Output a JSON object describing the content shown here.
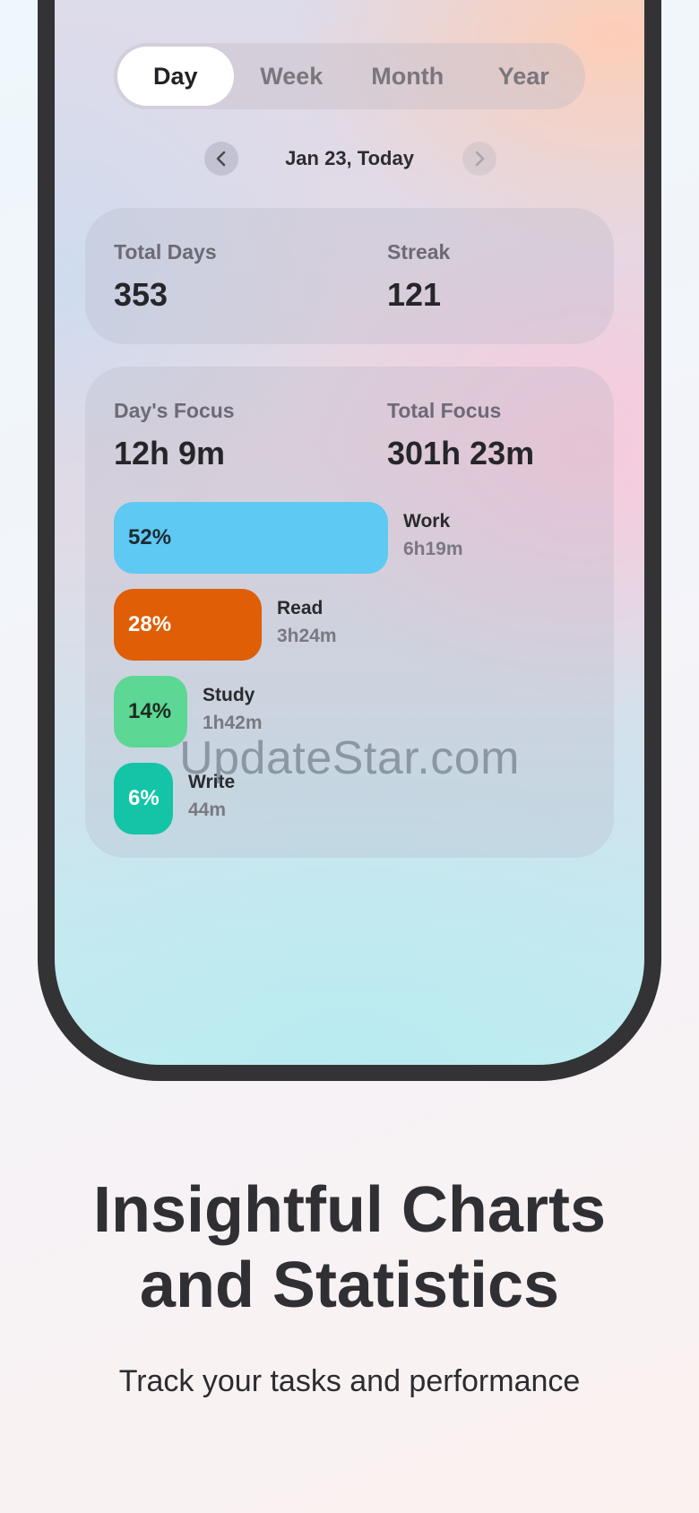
{
  "tabs": [
    {
      "label": "Day",
      "active": true
    },
    {
      "label": "Week",
      "active": false
    },
    {
      "label": "Month",
      "active": false
    },
    {
      "label": "Year",
      "active": false
    }
  ],
  "date_nav": {
    "label": "Jan 23, Today",
    "prev_icon": "chevron-left-icon",
    "next_icon": "chevron-right-icon"
  },
  "summary": {
    "total_days_label": "Total Days",
    "total_days_value": "353",
    "streak_label": "Streak",
    "streak_value": "121"
  },
  "focus": {
    "day_focus_label": "Day's Focus",
    "day_focus_value": "12h 9m",
    "total_focus_label": "Total Focus",
    "total_focus_value": "301h 23m"
  },
  "categories": [
    {
      "percent": "52%",
      "name": "Work",
      "time": "6h19m",
      "fraction": 0.52,
      "color": "#5ec9f2",
      "text_color": "#1e2a33"
    },
    {
      "percent": "28%",
      "name": "Read",
      "time": "3h24m",
      "fraction": 0.28,
      "color": "#df5e06",
      "text_color": "#ffffff"
    },
    {
      "percent": "14%",
      "name": "Study",
      "time": "1h42m",
      "fraction": 0.14,
      "color": "#5cd894",
      "text_color": "#1e2a22"
    },
    {
      "percent": "6%",
      "name": "Write",
      "time": "44m",
      "fraction": 0.06,
      "color": "#14c4a6",
      "text_color": "#ffffff"
    }
  ],
  "watermark": "UpdateStar.com",
  "promo": {
    "headline_line1": "Insightful Charts",
    "headline_line2": "and Statistics",
    "subtitle": "Track your tasks and performance"
  }
}
